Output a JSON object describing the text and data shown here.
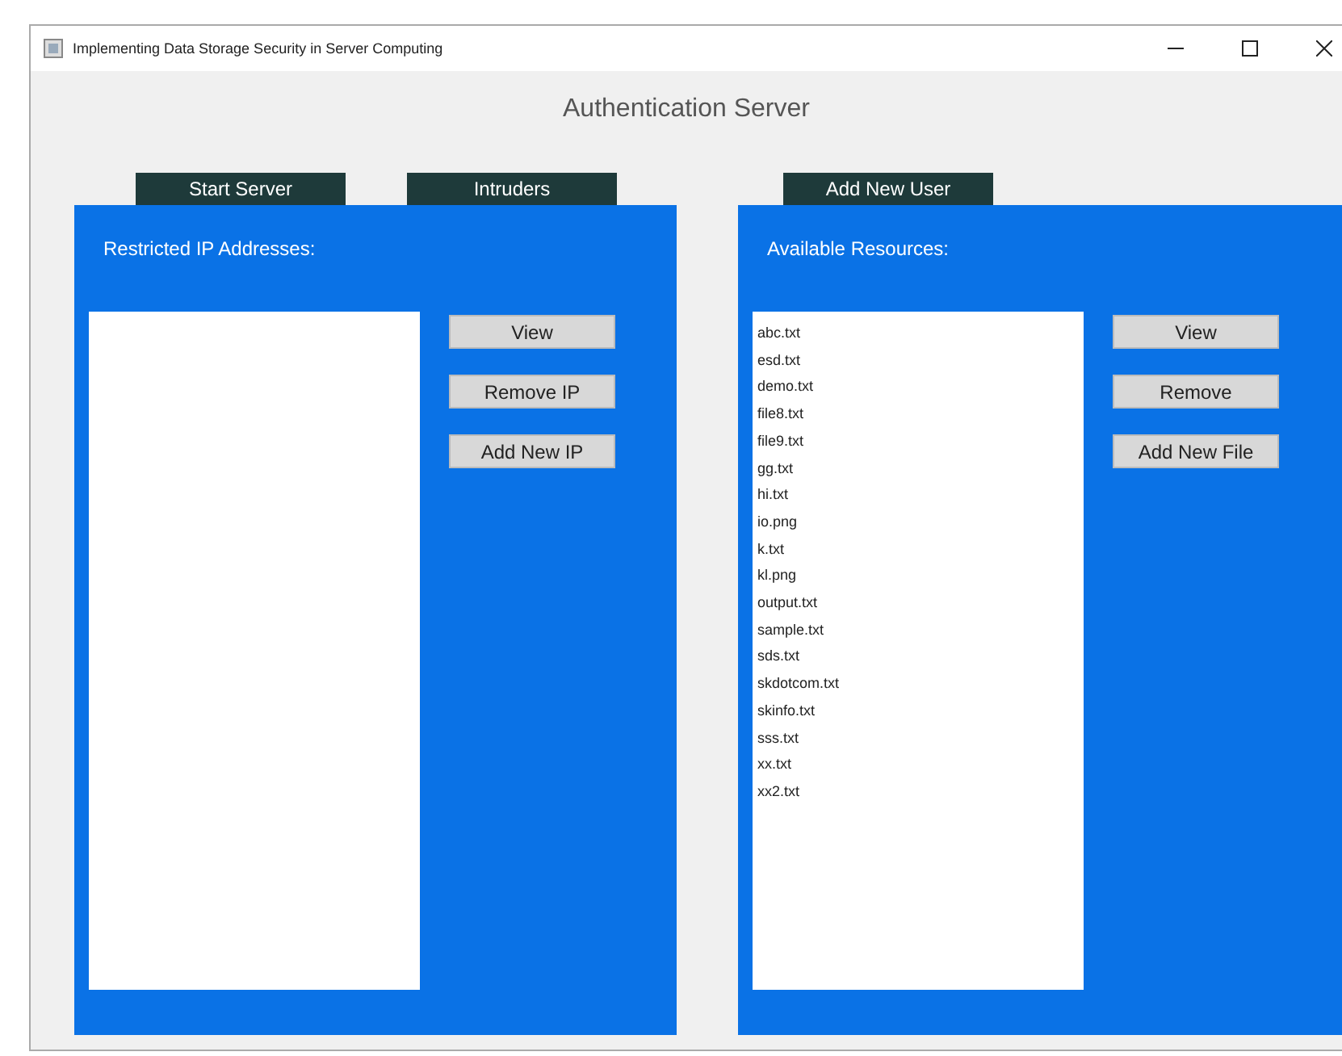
{
  "window": {
    "title": "Implementing Data Storage Security in Server Computing"
  },
  "heading": "Authentication Server",
  "panels": [
    {
      "tabs": [
        "Start Server",
        "Intruders"
      ],
      "label": "Restricted IP Addresses:",
      "buttons": [
        "View",
        "Remove IP",
        "Add New IP"
      ]
    },
    {
      "tabs": [
        "Add New User"
      ],
      "label": "Available Resources:",
      "items": [
        "abc.txt",
        "esd.txt",
        "demo.txt",
        "file8.txt",
        "file9.txt",
        "gg.txt",
        "hi.txt",
        "io.png",
        "k.txt",
        "kl.png",
        "output.txt",
        "sample.txt",
        "sds.txt",
        "skdotcom.txt",
        "skinfo.txt",
        "sss.txt",
        "xx.txt",
        "xx2.txt"
      ],
      "buttons": [
        "View",
        "Remove",
        "Add New File"
      ]
    }
  ]
}
